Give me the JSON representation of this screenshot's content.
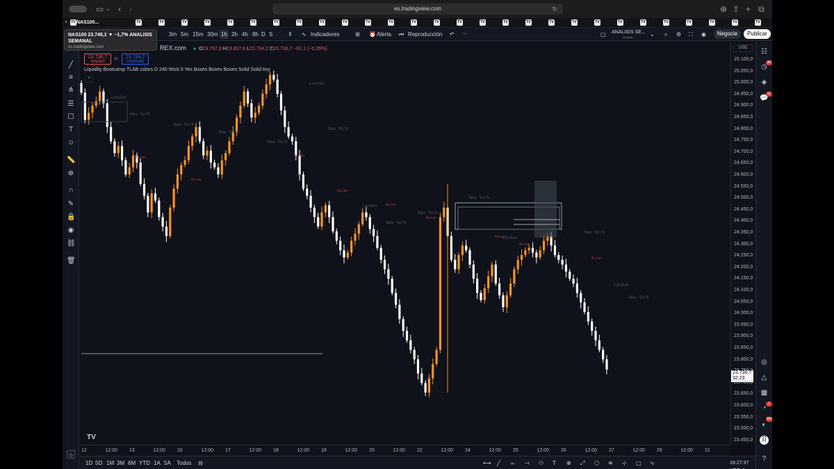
{
  "browser": {
    "url": "es.tradingview.com",
    "active_tab_label": "NAS100...",
    "tab_close": "×",
    "tab_icon_text": "TV",
    "tab_count": 32
  },
  "tooltip": {
    "title": "NAS100 23.745,1 ▼ −1,7% ANALISIS SEMANAL",
    "domain": "es.tradingview.com"
  },
  "toolbar": {
    "timeframes": [
      "3m",
      "5m",
      "15m",
      "30m",
      "1h",
      "2h",
      "4h",
      "8h",
      "D",
      "S"
    ],
    "active_timeframe": "1h",
    "indicators_label": "Indicadores",
    "alert_label": "Alerta",
    "replay_label": "Reproducción",
    "layout_name": "ANALISIS SE...",
    "layout_sub": "Guardar",
    "trade_label": "Negocie",
    "publish_label": "Publicar"
  },
  "legend": {
    "exchange": "REX.com",
    "o_label": "O",
    "o": "23.797,8",
    "h_label": "H",
    "h": "23.817,6",
    "l_label": "L",
    "l": "23.734,2",
    "c_label": "C",
    "c": "23.736,7",
    "change": "−61,1 (−0,26%)",
    "sell_price": "23.736,7",
    "sell_label": "VENDER",
    "spread": "15",
    "buy_price": "23.739,2",
    "buy_label": "COMPRAR",
    "indicator": "Liquidity Bootcamp TLAB colors D 240 Wick 0 Yes Boxes Boxes Boxes Solid Solid tiny",
    "collapse": "^"
  },
  "price_scale": {
    "currency": "USD",
    "ticks": [
      "25.100,0",
      "25.050,0",
      "25.000,0",
      "24.950,0",
      "24.900,0",
      "24.850,0",
      "24.800,0",
      "24.750,0",
      "24.700,0",
      "24.650,0",
      "24.600,0",
      "24.550,0",
      "24.500,0",
      "24.450,0",
      "24.400,0",
      "24.350,0",
      "24.300,0",
      "24.250,0",
      "24.200,0",
      "24.150,0",
      "24.100,0",
      "24.050,0",
      "24.000,0",
      "23.950,0",
      "23.900,0",
      "23.850,0",
      "23.800,0",
      "23.750,0",
      "23.700,0",
      "23.650,0",
      "23.600,0",
      "23.550,0",
      "23.500,0",
      "23.450,0"
    ],
    "last_price": "23.736,7",
    "countdown": "32:23"
  },
  "time_axis": {
    "ticks": [
      "12",
      "12:00",
      "13",
      "12:00",
      "15",
      "12:00",
      "17",
      "12:00",
      "18",
      "12:00",
      "19",
      "12:00",
      "20",
      "12:00",
      "22",
      "12:00",
      "24",
      "12:00",
      "25",
      "12:00",
      "26",
      "12:00",
      "27",
      "12:00",
      "29",
      "12:00",
      "31"
    ]
  },
  "bottom": {
    "ranges": [
      "1D",
      "5D",
      "1M",
      "3M",
      "6M",
      "YTD",
      "1A",
      "5A",
      "Todos"
    ],
    "clock": "18:27:37 UTC+1"
  },
  "chart_data": {
    "type": "candlestick",
    "title": "",
    "ylim": [
      23420,
      25120
    ],
    "session_labels": [
      "London",
      "New York",
      "Asian"
    ],
    "up_color": "#f7931a",
    "down_color": "#ffffff",
    "closes": [
      24905,
      24790,
      24820,
      24850,
      24870,
      24910,
      24860,
      24760,
      24700,
      24650,
      24680,
      24620,
      24560,
      24590,
      24640,
      24610,
      24520,
      24470,
      24400,
      24480,
      24450,
      24380,
      24340,
      24300,
      24420,
      24500,
      24560,
      24600,
      24620,
      24680,
      24720,
      24760,
      24700,
      24640,
      24660,
      24610,
      24590,
      24560,
      24620,
      24650,
      24700,
      24740,
      24800,
      24850,
      24910,
      24860,
      24800,
      24820,
      24850,
      24900,
      24940,
      24980,
      24960,
      24900,
      24830,
      24760,
      24720,
      24700,
      24640,
      24560,
      24500,
      24470,
      24420,
      24380,
      24340,
      24400,
      24430,
      24380,
      24320,
      24280,
      24240,
      24210,
      24230,
      24280,
      24310,
      24350,
      24400,
      24380,
      24330,
      24300,
      24250,
      24200,
      24160,
      24120,
      24060,
      24010,
      23950,
      23900,
      23860,
      23820,
      23780,
      23720,
      23680,
      23640,
      23700,
      23760,
      23820,
      24380,
      24420,
      24300,
      24200,
      24160,
      24220,
      24260,
      24240,
      24180,
      24120,
      24060,
      24030,
      24080,
      24130,
      24180,
      24100,
      24050,
      24000,
      24050,
      24100,
      24160,
      24200,
      24220,
      24240,
      24250,
      24230,
      24210,
      24240,
      24280,
      24300,
      24260,
      24220,
      24200,
      24180,
      24150,
      24120,
      24100,
      24060,
      24020,
      23980,
      23940,
      23900,
      23860,
      23820,
      23780,
      23737
    ],
    "last": 23736.7
  }
}
